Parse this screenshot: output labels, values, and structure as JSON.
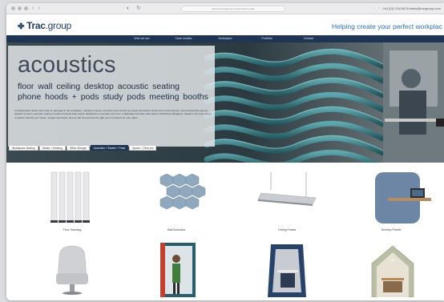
{
  "browser": {
    "url": "acoustics.tracgroup.com/acoustics-pods",
    "contact_line": "+44 (0)1 234 5678   sales@tracgroup.com"
  },
  "header": {
    "logo_text_bold": "Trac",
    "logo_text_light": ".group",
    "tagline": "Helping create your perfect workplac"
  },
  "nav": {
    "items": [
      "Who we are",
      "Case studies",
      "Workplace",
      "Portfolio",
      "Contact"
    ]
  },
  "hero": {
    "title": "acoustics",
    "subtitle_line1": "floor  wall  ceiling  desktop  acoustic seating",
    "subtitle_line2": "phone hoods + pods  study pods  meeting booths",
    "body": "Considerations about how noise is managed in the workplace, maintain a sense of privacy and comfort as people and teams share open environments. Sound absorbing panels, desktop screens, acoustic seating, booths and pods help reduce distractions so people can focus, collaborate and take calls without disturbing colleagues. Speak to the team about a solution that fits your space, budget and brand, and we will recommend the right mix of products for your office.",
    "tabs": [
      {
        "label": "Workspace Seating",
        "active": false
      },
      {
        "label": "Tables + Desking",
        "active": false
      },
      {
        "label": "Office Storage",
        "active": false
      },
      {
        "label": "Acoustics + Booths + Pods",
        "active": true
      },
      {
        "label": "Sports + Dens etc",
        "active": false
      }
    ]
  },
  "products": [
    {
      "caption": "Floor Standing"
    },
    {
      "caption": "Wall Acoustics"
    },
    {
      "caption": "Ceiling Panels"
    },
    {
      "caption": "Desktop Panels"
    },
    {
      "caption": ""
    },
    {
      "caption": ""
    },
    {
      "caption": ""
    },
    {
      "caption": ""
    }
  ],
  "colors": {
    "brand_navy": "#1e3553",
    "tagline_blue": "#2e6fb3",
    "acoustic_teal": "#3f8a92"
  }
}
